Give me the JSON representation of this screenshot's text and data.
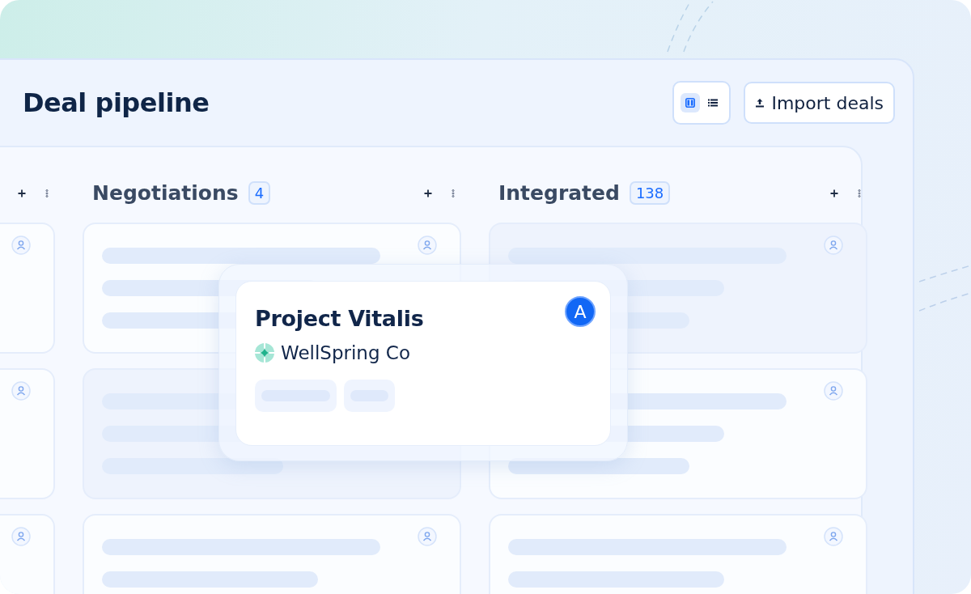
{
  "page": {
    "title": "Deal pipeline"
  },
  "view_toggle": [
    {
      "kind": "board",
      "selected": true
    },
    {
      "kind": "list",
      "selected": false
    }
  ],
  "import_button": {
    "label": "Import deals"
  },
  "columns": [
    {
      "cards": [
        {
          "kind": "edge",
          "shaded": false
        },
        {
          "kind": "edge",
          "shaded": false
        },
        {
          "kind": "edge",
          "shaded": false
        }
      ]
    },
    {
      "title": "Negotiations",
      "count": "4",
      "cards": [
        {
          "kind": "skeleton",
          "shaded": false
        },
        {
          "kind": "covered",
          "shaded": true
        },
        {
          "kind": "partial",
          "shaded": false
        }
      ]
    },
    {
      "title": "Integrated",
      "count": "138",
      "cards": [
        {
          "kind": "skeleton",
          "shaded": true
        },
        {
          "kind": "skeleton",
          "shaded": false
        },
        {
          "kind": "partial",
          "shaded": false
        }
      ]
    }
  ],
  "dragged_card": {
    "title": "Project Vitalis",
    "company": "WellSpring Co",
    "avatar": "A"
  }
}
